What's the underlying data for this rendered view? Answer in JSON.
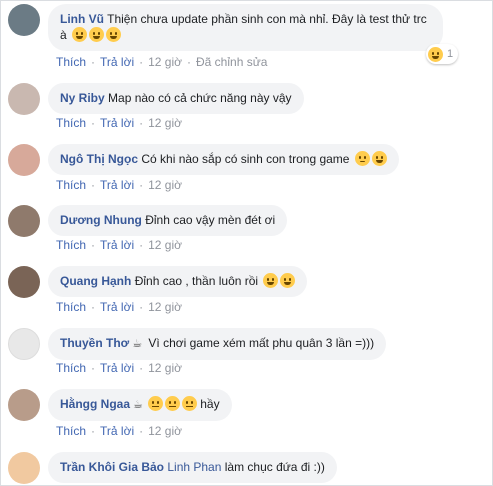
{
  "comments": [
    {
      "author": "Linh Vũ",
      "text": "Thiện chưa update phần sinh con mà nhỉ. Đây là test thử trc à",
      "like": "Thích",
      "reply": "Trả lời",
      "time": "12 giờ",
      "edited": "Đã chỉnh sửa",
      "reaction_count": "1",
      "avatar_color": "#6b7b85"
    },
    {
      "author": "Ny Riby",
      "text": "Map nào có cả chức năng này vậy",
      "like": "Thích",
      "reply": "Trả lời",
      "time": "12 giờ",
      "avatar_color": "#c9b8b0"
    },
    {
      "author": "Ngô Thị Ngọc",
      "text": "Có khi nào sắp có sinh con trong game",
      "like": "Thích",
      "reply": "Trả lời",
      "time": "12 giờ",
      "avatar_color": "#d7a99a"
    },
    {
      "author": "Dương Nhung",
      "text": "Đỉnh cao vậy mèn đét ơi",
      "like": "Thích",
      "reply": "Trả lời",
      "time": "12 giờ",
      "avatar_color": "#8f7a6c"
    },
    {
      "author": "Quang Hạnh",
      "text": "Đỉnh cao , thần luôn rồi",
      "like": "Thích",
      "reply": "Trả lời",
      "time": "12 giờ",
      "avatar_color": "#7a6456"
    },
    {
      "author": "Thuyền Thơ",
      "text": "Vì chơi game xém mất phu quân 3 lần =)))",
      "like": "Thích",
      "reply": "Trả lời",
      "time": "12 giờ",
      "avatar_color": "#e8e8e8"
    },
    {
      "author": "Hằngg Ngaa",
      "text": "hầy",
      "like": "Thích",
      "reply": "Trả lời",
      "time": "12 giờ",
      "avatar_color": "#b89c8a"
    },
    {
      "author": "Trần Khôi Gia Bảo",
      "mention": "Linh Phan",
      "text": "làm chục đứa đi :))",
      "avatar_color": "#f1c9a0"
    }
  ]
}
